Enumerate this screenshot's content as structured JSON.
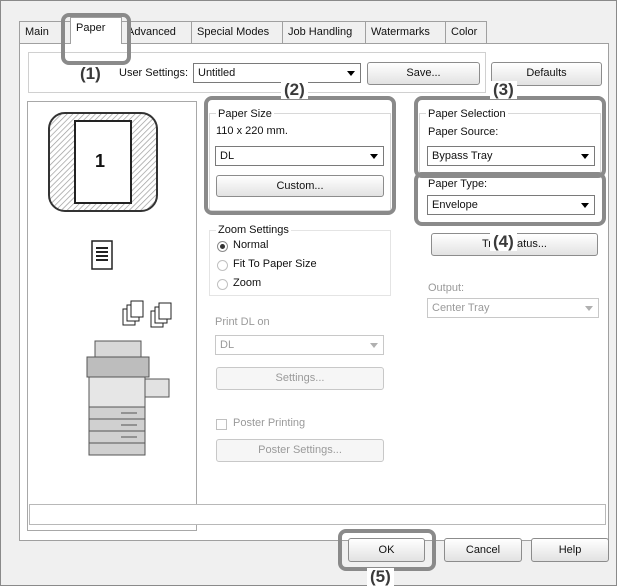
{
  "tabs": [
    {
      "label": "Main"
    },
    {
      "label": "Paper"
    },
    {
      "label": "Advanced"
    },
    {
      "label": "Special Modes"
    },
    {
      "label": "Job Handling"
    },
    {
      "label": "Watermarks"
    },
    {
      "label": "Color"
    }
  ],
  "user_settings": {
    "label": "User Settings:",
    "value": "Untitled",
    "save_label": "Save...",
    "defaults_label": "Defaults"
  },
  "preview": {
    "page_number": "1"
  },
  "paper_size": {
    "title": "Paper Size",
    "dimensions": "110 x 220 mm.",
    "value": "DL",
    "custom_label": "Custom..."
  },
  "paper_selection": {
    "title": "Paper Selection",
    "source_label": "Paper Source:",
    "source_value": "Bypass Tray"
  },
  "paper_type": {
    "label": "Paper Type:",
    "value": "Envelope",
    "tray_button_label": "Tray Status..."
  },
  "zoom": {
    "title": "Zoom Settings",
    "options": [
      "Normal",
      "Fit To Paper Size",
      "Zoom"
    ],
    "selected": "Normal"
  },
  "print_on": {
    "label": "Print DL on",
    "value": "DL",
    "settings_label": "Settings..."
  },
  "output": {
    "label": "Output:",
    "value": "Center Tray"
  },
  "poster": {
    "checkbox_label": "Poster Printing",
    "settings_label": "Poster Settings..."
  },
  "footer": {
    "ok_label": "OK",
    "cancel_label": "Cancel",
    "help_label": "Help"
  },
  "callouts": [
    "(1)",
    "(2)",
    "(3)",
    "(4)",
    "(5)"
  ],
  "colors": {
    "callout_border": "#8a8a8a",
    "callout_text": "#3a3a3a"
  }
}
